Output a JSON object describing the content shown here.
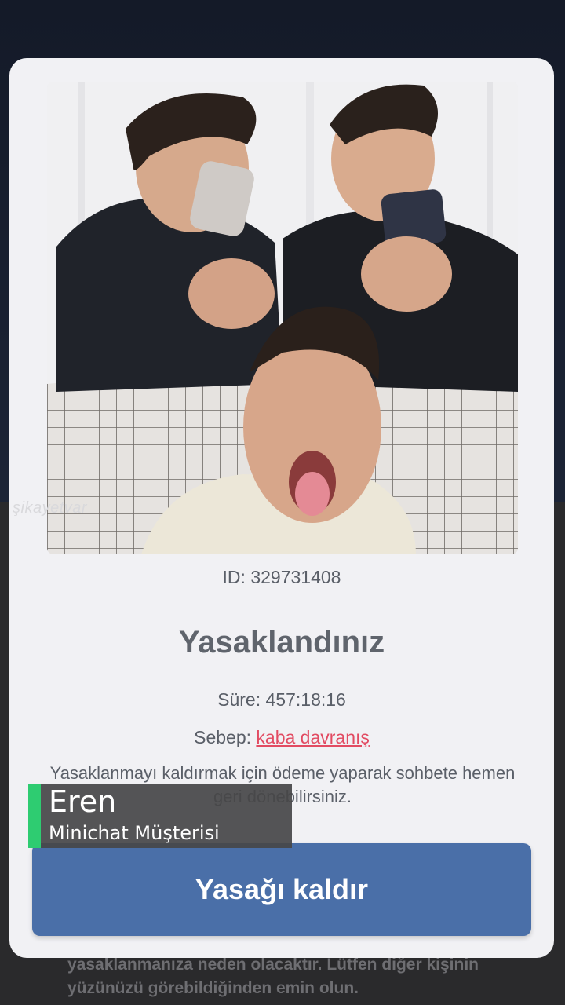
{
  "background": {
    "caption": "yasaklanmanıza neden olacaktır. Lütfen diğer kişinin yüzünüzü görebildiğinden emin olun."
  },
  "ban_dialog": {
    "user_id": "ID: 329731408",
    "title": "Yasaklandınız",
    "duration_label": "Süre:",
    "duration_value": "457:18:16",
    "reason_label": "Sebep:",
    "reason_value": "kaba davranış",
    "description": "Yasaklanmayı kaldırmak için ödeme yaparak sohbete hemen geri dönebilirsiniz.",
    "unban_button": "Yasağı kaldır"
  },
  "watermark": "şikayetvar",
  "lower_third": {
    "name": "Eren",
    "role": "Minichat Müşterisi"
  },
  "colors": {
    "button": "#4a6fa8",
    "reason_link": "#e24b62",
    "lower_third_accent": "#2ecc71"
  }
}
